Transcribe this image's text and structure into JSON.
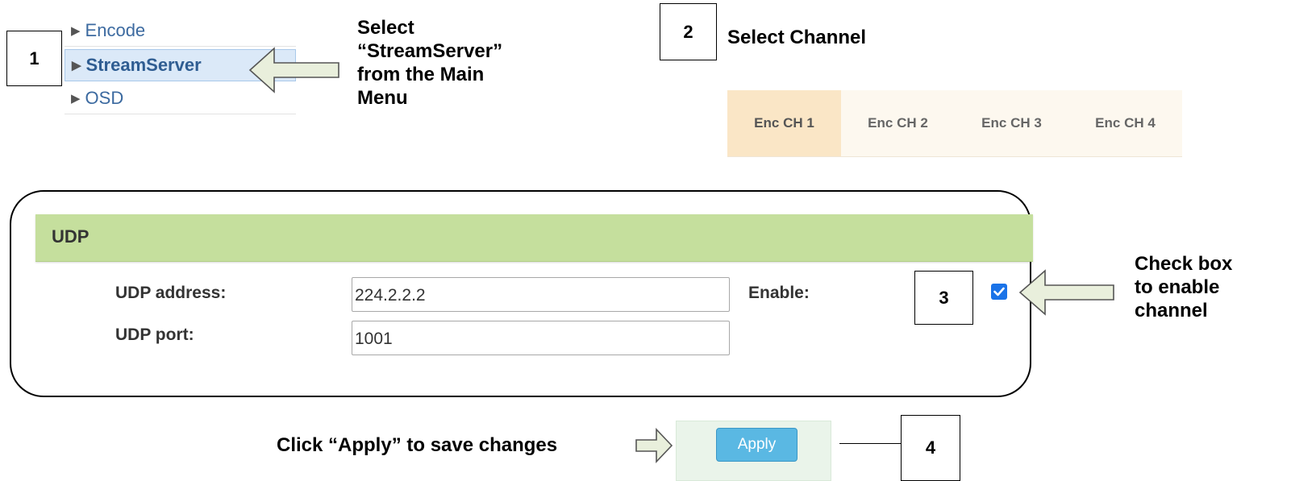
{
  "steps": {
    "one": "1",
    "two": "2",
    "three": "3",
    "four": "4"
  },
  "menu": {
    "items": [
      {
        "label": "Encode"
      },
      {
        "label": "StreamServer"
      },
      {
        "label": "OSD"
      }
    ]
  },
  "callouts": {
    "step1": [
      "Select",
      "“StreamServer”",
      "from the Main",
      "Menu"
    ],
    "step2": "Select Channel",
    "step3": [
      "Check box",
      "to enable",
      "channel"
    ],
    "step4": "Click “Apply” to save changes"
  },
  "tabs": [
    {
      "label": "Enc CH 1",
      "selected": true
    },
    {
      "label": "Enc CH 2",
      "selected": false
    },
    {
      "label": "Enc CH 3",
      "selected": false
    },
    {
      "label": "Enc CH 4",
      "selected": false
    }
  ],
  "udp": {
    "header": "UDP",
    "address_label": "UDP address:",
    "address_value": "224.2.2.2",
    "port_label": "UDP port:",
    "port_value": "1001",
    "enable_label": "Enable:",
    "enable_checked": true
  },
  "apply_label": "Apply",
  "colors": {
    "udp_header": "#c5df9d",
    "tab_selected": "#fae6c6",
    "menu_active": "#dbe9f8",
    "apply_button": "#5ab8e3",
    "checkbox": "#1a73e8",
    "arrow_fill": "#e9efdc"
  },
  "icons": {
    "menu_bullet": "right-triangle-icon",
    "callout_arrow": "left-arrow-icon",
    "checkbox": "checkmark-icon"
  }
}
